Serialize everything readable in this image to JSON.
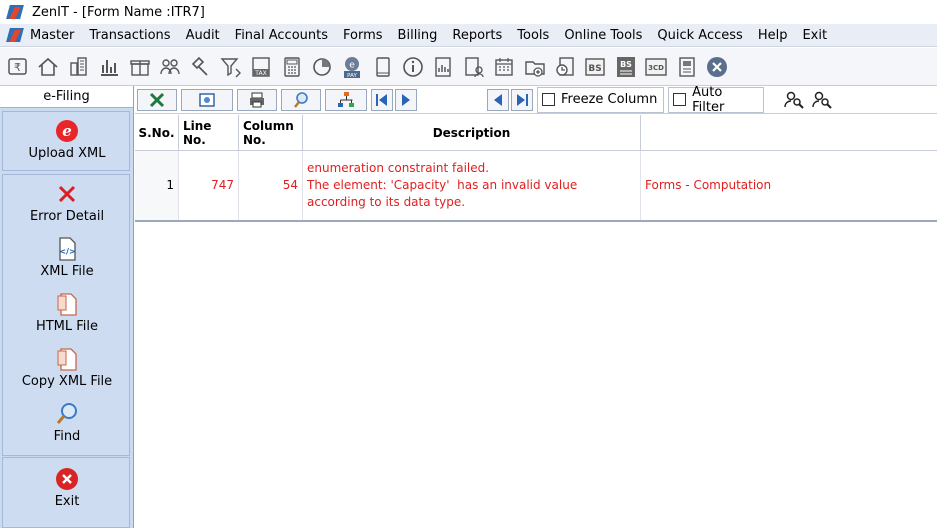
{
  "titlebar": {
    "title": "ZenIT - [Form Name :ITR7]"
  },
  "menu": {
    "items": [
      "Master",
      "Transactions",
      "Audit",
      "Final Accounts",
      "Forms",
      "Billing",
      "Reports",
      "Tools",
      "Online Tools",
      "Quick Access",
      "Help",
      "Exit"
    ]
  },
  "toolbar": {
    "icons": [
      "rupee-icon",
      "home-icon",
      "building-icon",
      "bar-chart-icon",
      "gift-icon",
      "users-icon",
      "gavel-icon",
      "filter-icon",
      "tax-icon",
      "calculator-icon",
      "pie-chart-icon",
      "epay-icon",
      "book-icon",
      "info-icon",
      "report-icon",
      "user-document-icon",
      "calendar-icon",
      "folder-add-icon",
      "refresh-document-icon",
      "balance-sheet-icon",
      "balance-sheet-alt-icon",
      "form-3cd-icon",
      "form-icon",
      "close-icon"
    ],
    "labels": {
      "tax": "TAX",
      "pay": "PAY",
      "bs": "BS",
      "cd": "3CD"
    }
  },
  "sidebar": {
    "header": "e-Filing",
    "items": {
      "upload_xml": "Upload XML",
      "error_detail": "Error Detail",
      "xml_file": "XML File",
      "html_file": "HTML File",
      "copy_xml_file": "Copy XML File",
      "find": "Find",
      "exit": "Exit"
    }
  },
  "grid_toolbar": {
    "freeze_column": "Freeze Column",
    "auto_filter": "Auto Filter"
  },
  "grid": {
    "columns": [
      "S.No.",
      "Line No.",
      "Column No.",
      "Description",
      ""
    ],
    "rows": [
      {
        "sno": "1",
        "line": "747",
        "column": "54",
        "description_line1": "enumeration constraint failed.",
        "description_line2": "The element: 'Capacity'  has an invalid value",
        "description_line3": "according to its data type.",
        "section": "Forms - Computation"
      }
    ]
  },
  "colors": {
    "error_text": "#e02020",
    "sidebar_bg": "#c9daf1"
  }
}
